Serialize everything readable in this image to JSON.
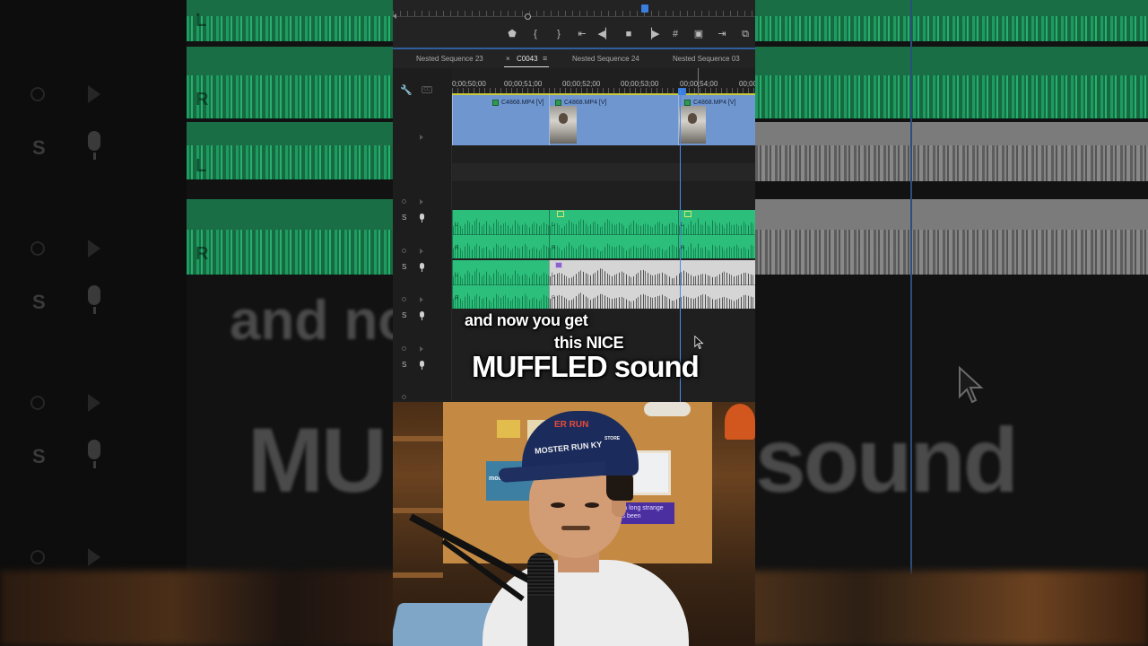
{
  "tabs": [
    "Nested Sequence 23",
    "C0043",
    "Nested Sequence 24",
    "Nested Sequence 03"
  ],
  "active_tab_menu_icon": "hamburger-icon",
  "timecodes": [
    "0;00;50;00",
    "00;00;51;00",
    "00;00;52;00",
    "00;00;53;00",
    "00;00;54;00",
    "00;00"
  ],
  "clips": {
    "video": [
      "C4868.MP4 [V]",
      "C4868.MP4 [V]",
      "C4868.MP4 [V]"
    ]
  },
  "track_controls": {
    "solo": "S",
    "channels": [
      "L",
      "R"
    ]
  },
  "transport_icons": [
    "marker-icon",
    "mark-in-icon",
    "mark-out-icon",
    "go-to-in-icon",
    "step-back-icon",
    "stop-icon",
    "step-forward-icon",
    "safe-margins-icon",
    "camera-icon",
    "insert-icon",
    "overwrite-icon"
  ],
  "captions": {
    "line1": "and now you get",
    "line2": "this NICE",
    "line3": "MUFFLED sound"
  },
  "background_captions": {
    "line1": "and no",
    "line3a": "MU",
    "line3b": "sound"
  },
  "webcam": {
    "cap_text_1": "ER RUN",
    "cap_text_2": "STORE",
    "cap_text_3": "MOSTER RUN KY",
    "poster_text": "mount-bo",
    "sticker_text": "What a long strange trip it's been"
  },
  "colors": {
    "audio_clip": "#2cbf7c",
    "video_clip": "#6f96cf",
    "playhead": "#4a8be6",
    "muted_clip": "#d5d5d5"
  }
}
